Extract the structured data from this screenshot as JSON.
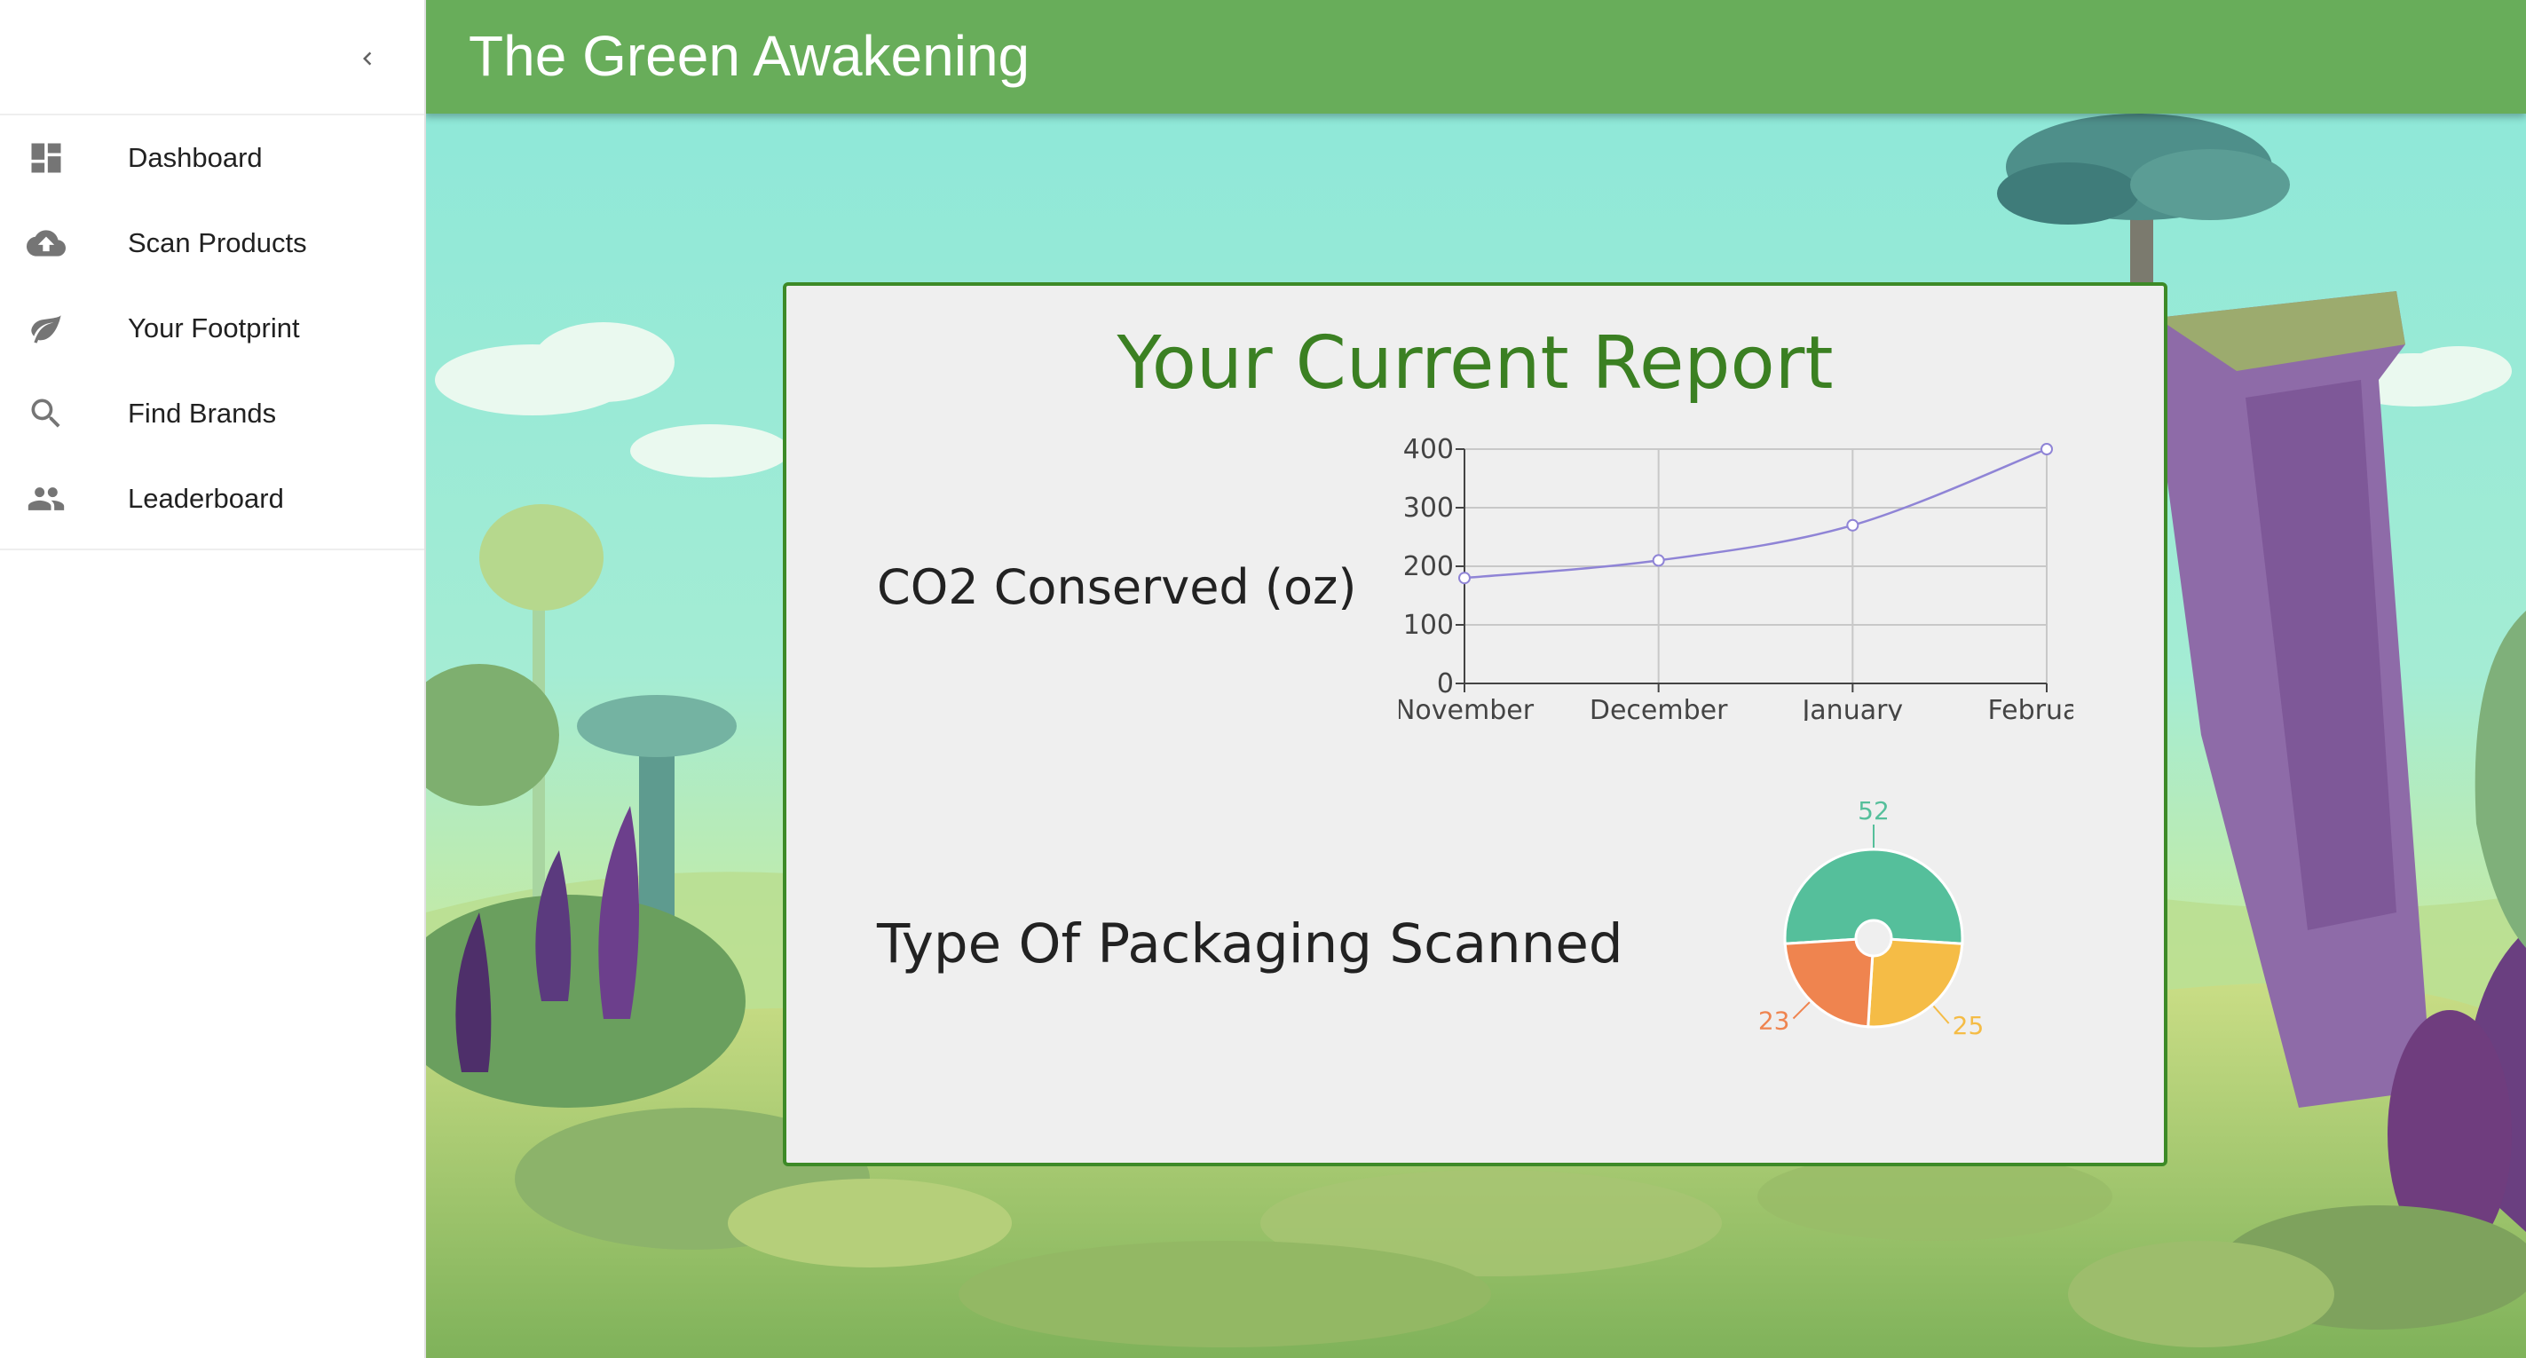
{
  "sidebar": {
    "items": [
      {
        "label": "Dashboard",
        "icon": "dashboard-icon"
      },
      {
        "label": "Scan Products",
        "icon": "cloud-upload-icon"
      },
      {
        "label": "Your Footprint",
        "icon": "leaf-icon"
      },
      {
        "label": "Find Brands",
        "icon": "search-icon"
      },
      {
        "label": "Leaderboard",
        "icon": "people-icon"
      }
    ]
  },
  "header": {
    "title": "The Green Awakening"
  },
  "report": {
    "title": "Your Current Report",
    "co2_label": "CO2 Conserved (oz)",
    "packaging_label": "Type Of Packaging Scanned"
  },
  "colors": {
    "appbar": "#68ad5a",
    "card_border": "#3d8a27",
    "title_green": "#3b8022",
    "line": "#8f84d6",
    "pie_green": "#55bf9b",
    "pie_orange": "#ef844f",
    "pie_yellow": "#f5bc46"
  },
  "chart_data": [
    {
      "type": "line",
      "categories": [
        "November",
        "December",
        "January",
        "February"
      ],
      "values": [
        180,
        210,
        270,
        400
      ],
      "title": "",
      "xlabel": "",
      "ylabel": "",
      "ylim": [
        0,
        400
      ],
      "yticks": [
        0,
        100,
        200,
        300,
        400
      ],
      "grid": true,
      "color": "#8f84d6"
    },
    {
      "type": "pie",
      "donut": true,
      "values": [
        52,
        25,
        23
      ],
      "colors": [
        "#55bf9b",
        "#f5bc46",
        "#ef844f"
      ],
      "labels": [
        "52",
        "25",
        "23"
      ]
    }
  ]
}
